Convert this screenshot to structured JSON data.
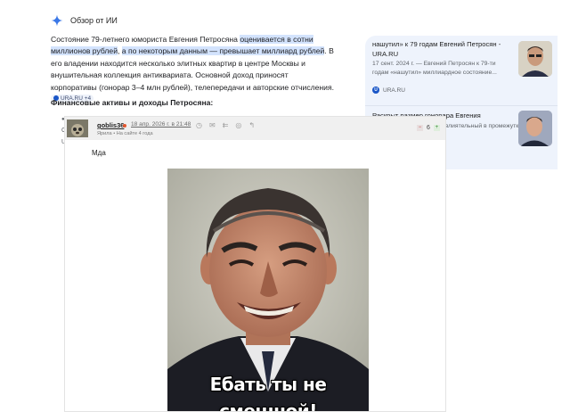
{
  "ai_overview": {
    "header": "Обзор от ИИ",
    "p_start": "Состояние 79-летнего юмориста Евгения Петросяна ",
    "p_hl1": "оценивается в сотни миллионов рублей",
    "p_mid": ", ",
    "p_hl2": "а по некоторым данным — превышает миллиард рублей",
    "p_end": ". В его владении находится несколько элитных квартир в центре Москвы и внушительная коллекция антиквариата. Основной доход приносят корпоративы (гонорар 3–4 млн рублей), телепередачи и авторские отчисления.",
    "source_chip": "URA.RU +4",
    "finance_title": "Финансовые активы и доходы Петросяна:",
    "bullet_frag1": "●",
    "bullet_frag2": "С",
    "bullet_frag3": "U"
  },
  "cards": [
    {
      "title": "нашутил» к 79 годам Евгений Петросян - URA.RU",
      "meta": "17 сент. 2024 г. — Евгений Петросян к 79-ти годам «нашутил» миллиардное состояние...",
      "source": "URA.RU"
    },
    {
      "title": "Раскрыт размер гонорара Евгения Петросяна",
      "meta": "статочно влиятельный в промежутке от 3...",
      "source": ""
    }
  ],
  "comment": {
    "username": "goblis36",
    "date": "18 апр. 2026 г. в 21:48",
    "user_label": "Ярила",
    "user_sub": "• На сайте 4 года",
    "rating": "6",
    "text": "Мда",
    "caption_line1": "Ебать ты не",
    "caption_line2": "смешной!"
  },
  "colors": {
    "highlight": "#d3e3fd",
    "card_bg": "#eef3fc",
    "accent_blue": "#1a56c7",
    "comment_header": "#f0f0f0"
  },
  "icons": {
    "ai_spark": "sparkle-icon",
    "comment_actions": [
      "clock-icon",
      "mail-icon",
      "reply-all-icon",
      "chat-icon",
      "reply-icon"
    ]
  }
}
